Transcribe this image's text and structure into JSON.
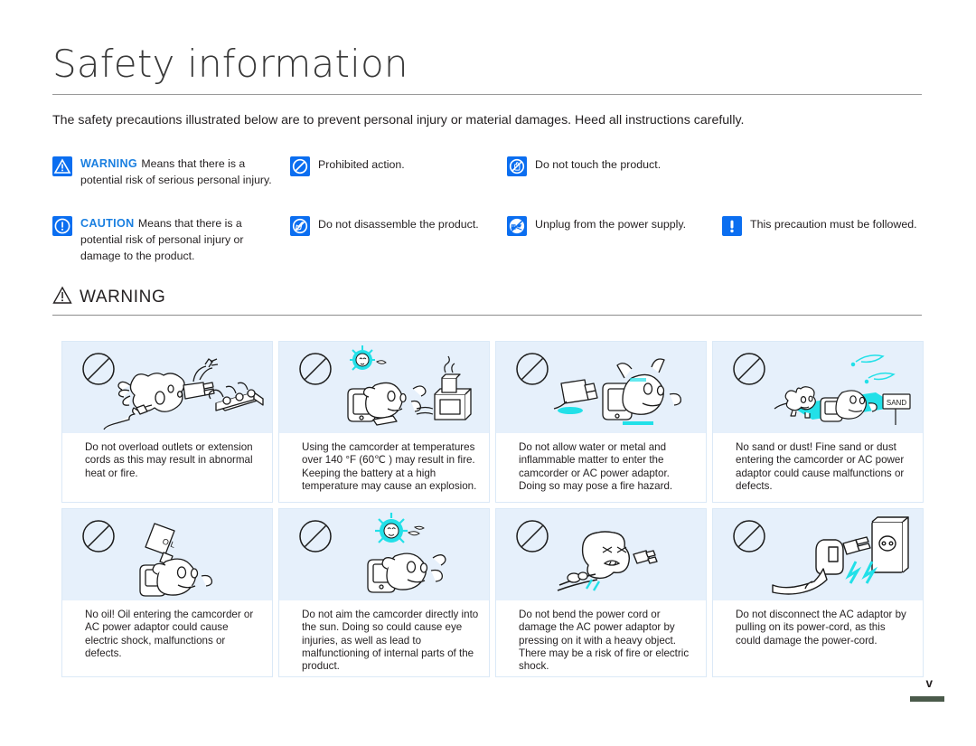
{
  "page": {
    "title": "Safety information",
    "intro": "The safety precautions illustrated below are to prevent personal injury or material damages. Heed all instructions carefully.",
    "page_marker": "v"
  },
  "legend": {
    "warning": {
      "icon": "warning-triangle-icon",
      "heading": "WARNING",
      "body": "Means that there is a potential risk of serious personal injury."
    },
    "caution": {
      "icon": "exclamation-circle-icon",
      "heading": "CAUTION",
      "body": "Means that there is a potential risk of personal injury or damage to the product."
    },
    "prohibited": {
      "icon": "prohibition-icon",
      "label": "Prohibited action."
    },
    "no_disassemble": {
      "icon": "no-disassemble-icon",
      "label": "Do not disassemble the product."
    },
    "no_touch": {
      "icon": "no-touch-hand-icon",
      "label": "Do not touch the product."
    },
    "unplug": {
      "icon": "unplug-power-icon",
      "label": "Unplug from the power supply."
    },
    "must_follow": {
      "icon": "exclamation-bar-icon",
      "label": "This precaution must be followed."
    }
  },
  "section": {
    "icon": "warning-triangle-outline-icon",
    "heading": "WARNING"
  },
  "cards": [
    {
      "art": "overloaded-outlet-illustration",
      "text": "Do not overload outlets or extension cords as this may result in abnormal heat or fire."
    },
    {
      "art": "camcorder-high-temperature-illustration",
      "text": "Using the camcorder at temperatures over 140 °F (60℃ ) may result in fire. Keeping the battery at a high temperature may cause an explosion."
    },
    {
      "art": "water-metal-entering-illustration",
      "text": "Do not allow water or metal and inflammable matter to enter the camcorder or AC power adaptor. Doing so may pose a fire hazard."
    },
    {
      "art": "sand-dust-illustration",
      "text": "No sand or dust! Fine sand or dust entering the camcorder or AC power adaptor could cause malfunctions or defects."
    },
    {
      "art": "oil-entering-illustration",
      "text": "No oil! Oil entering the camcorder or AC power adaptor could cause electric shock, malfunctions or defects."
    },
    {
      "art": "aim-at-sun-illustration",
      "text": "Do not aim the camcorder directly into the sun. Doing so could cause eye injuries, as well as lead to malfunctioning of internal parts of the product."
    },
    {
      "art": "bent-power-cord-illustration",
      "text": "Do not bend the power cord or damage the AC power adaptor by pressing on it with a heavy object. There may be a risk of fire or electric shock."
    },
    {
      "art": "pulling-power-cord-illustration",
      "text": "Do not disconnect the AC adaptor by pulling on its power-cord, as this could damage the power-cord."
    }
  ],
  "colors": {
    "legend_icon_blue": "#0b6ef0",
    "legend_heading_blue": "#1a7fe0",
    "card_art_background": "#e6f0fb",
    "card_border": "#dbe9f7",
    "accent_cyan": "#22e0e8",
    "text": "#231f20"
  },
  "art_labels": {
    "sand_sign": "SAND",
    "oil_bottle": "OIL"
  }
}
